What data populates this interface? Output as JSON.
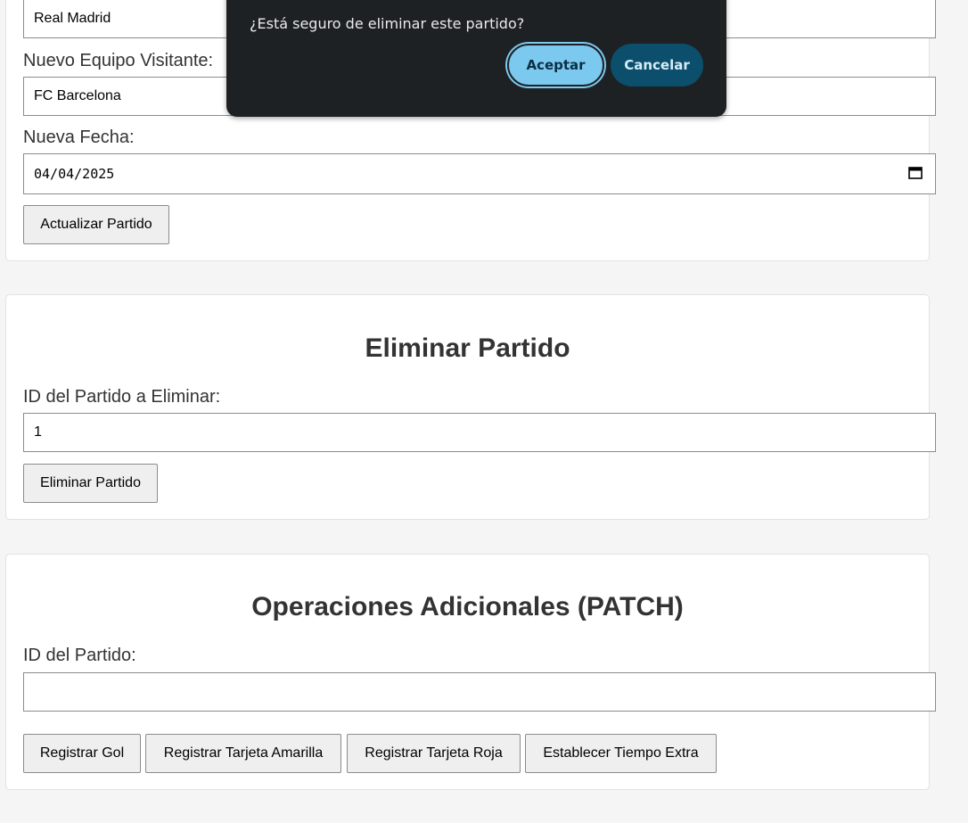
{
  "update_card": {
    "home_value": "Real Madrid",
    "away_label": "Nuevo Equipo Visitante:",
    "away_value": "FC Barcelona",
    "date_label": "Nueva Fecha:",
    "date_value": "04/04/2025",
    "update_button": "Actualizar Partido"
  },
  "delete_card": {
    "title": "Eliminar Partido",
    "id_label": "ID del Partido a Eliminar:",
    "id_value": "1",
    "delete_button": "Eliminar Partido"
  },
  "patch_card": {
    "title": "Operaciones Adicionales (PATCH)",
    "id_label": "ID del Partido:",
    "id_value": "",
    "buttons": [
      "Registrar Gol",
      "Registrar Tarjeta Amarilla",
      "Registrar Tarjeta Roja",
      "Establecer Tiempo Extra"
    ]
  },
  "dialog": {
    "message": "¿Está seguro de eliminar este partido?",
    "accept": "Aceptar",
    "cancel": "Cancelar"
  },
  "icons": {
    "date_picker": "calendar-icon"
  }
}
